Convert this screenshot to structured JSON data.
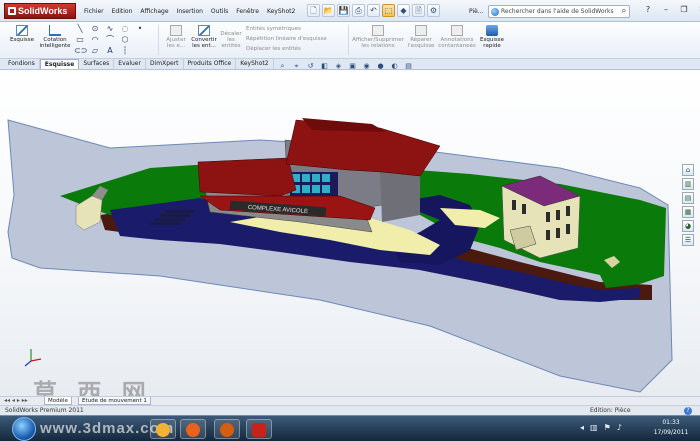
{
  "app": {
    "logo_text": "SolidWorks",
    "menu": [
      "Fichier",
      "Edition",
      "Affichage",
      "Insertion",
      "Outils",
      "Fenêtre",
      "KeyShot2"
    ],
    "doc_type": "Piè...",
    "search_placeholder": "Rechercher dans l'aide de SolidWorks",
    "window_buttons": [
      "?",
      "–",
      "❐",
      "✕"
    ]
  },
  "quick_access": [
    {
      "icon": "new-document-icon",
      "glyph": "🗋"
    },
    {
      "icon": "open-folder-icon",
      "glyph": "📂"
    },
    {
      "icon": "save-icon",
      "glyph": "💾"
    },
    {
      "icon": "print-icon",
      "glyph": "⎙"
    },
    {
      "icon": "undo-icon",
      "glyph": "↶"
    },
    {
      "icon": "select-arrow-icon",
      "glyph": "⬚"
    },
    {
      "icon": "rebuild-icon",
      "glyph": "◆"
    },
    {
      "icon": "file-properties-icon",
      "glyph": "🗎"
    },
    {
      "icon": "options-icon",
      "glyph": "⚙"
    }
  ],
  "ribbon": {
    "esquisse": "Esquisse",
    "cotation": [
      "Cotation",
      "intelligente"
    ],
    "ajuster": [
      "Ajuster",
      "les e..."
    ],
    "convertir": [
      "Convertir",
      "les ent..."
    ],
    "decaler": [
      "Décaler",
      "les",
      "entités"
    ],
    "entities_list": [
      "Entités symétriques",
      "Répétition linéaire d'esquisse",
      "Déplacer les entités"
    ],
    "relations": [
      "Afficher/Supprimer",
      "les relations"
    ],
    "reparer": [
      "Réparer",
      "l'esquisse"
    ],
    "animations": [
      "Annotations",
      "contantaneés"
    ],
    "esquisse_rapide": [
      "Esquisse",
      "rapide"
    ]
  },
  "tabs": [
    {
      "label": "Fondions",
      "active": false
    },
    {
      "label": "Esquisse",
      "active": true
    },
    {
      "label": "Surfaces",
      "active": false
    },
    {
      "label": "Evaluer",
      "active": false
    },
    {
      "label": "DimXpert",
      "active": false
    },
    {
      "label": "Produits Office",
      "active": false
    },
    {
      "label": "KeyShot2",
      "active": false
    }
  ],
  "hud_icons": [
    "zoom-fit-icon",
    "zoom-area-icon",
    "previous-view-icon",
    "section-view-icon",
    "view-orientation-icon",
    "display-style-icon",
    "hide-show-icon",
    "edit-appearance-icon",
    "apply-scene-icon",
    "view-settings-icon"
  ],
  "scene": {
    "sign_text": "COMPLEXE AVICOLE"
  },
  "task_pane_icons": [
    "resources-icon",
    "design-library-icon",
    "file-explorer-icon",
    "view-palette-icon",
    "appearances-icon",
    "custom-properties-icon"
  ],
  "watermark": {
    "chinese": "草 西 网",
    "taskbar_text": "www.3dmax.com"
  },
  "model_tabs": [
    {
      "label": "Modèle",
      "active": true
    },
    {
      "label": "Etude de mouvement 1",
      "active": false
    }
  ],
  "status": {
    "left": "SolidWorks Premium 2011",
    "right": "Edition: Pièce",
    "help": "?"
  },
  "taskbar": {
    "time": "01:33",
    "date": "17/09/2011",
    "apps": [
      {
        "name": "explorer-app-icon",
        "color": "#f2b233"
      },
      {
        "name": "firefox-app-icon",
        "color": "#e8621c"
      },
      {
        "name": "mediaplayer-app-icon",
        "color": "#d45d10"
      },
      {
        "name": "solidworks-app-icon",
        "color": "#c8231b"
      }
    ]
  },
  "colors": {
    "roof": "#8d1212",
    "grass": "#0a7a0a",
    "base": "#1b1b6b",
    "plaza": "#f0eeaa",
    "wall": "#5a1f14",
    "platform": "#bcc3d6"
  }
}
